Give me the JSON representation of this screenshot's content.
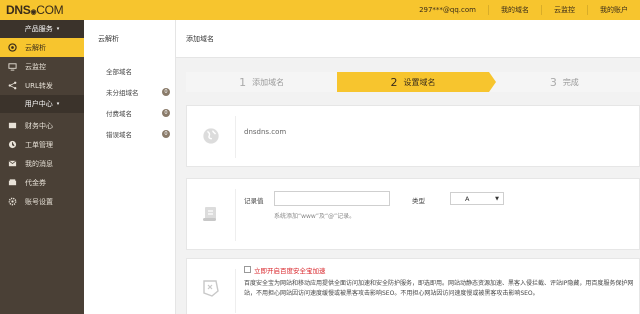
{
  "header": {
    "logo_main": "DNS",
    "logo_suffix": "COM",
    "links": [
      "297***@qq.com",
      "我的域名",
      "云监控",
      "我的账户"
    ]
  },
  "sidebar": {
    "group_products": "产品服务",
    "product_items": [
      {
        "label": "云解析",
        "icon": "cloud-dns-icon",
        "active": true
      },
      {
        "label": "云监控",
        "icon": "monitor-icon",
        "active": false
      },
      {
        "label": "URL转发",
        "icon": "share-icon",
        "active": false
      }
    ],
    "group_user": "用户中心",
    "user_items": [
      {
        "label": "财务中心",
        "icon": "finance-icon"
      },
      {
        "label": "工单管理",
        "icon": "ticket-icon"
      },
      {
        "label": "我的消息",
        "icon": "message-icon"
      },
      {
        "label": "代金券",
        "icon": "coupon-icon"
      },
      {
        "label": "账号设置",
        "icon": "gear-icon"
      }
    ]
  },
  "subsidebar": {
    "title": "云解析",
    "items": [
      {
        "label": "全部域名"
      },
      {
        "label": "未分组域名",
        "badge": "0"
      },
      {
        "label": "付费域名",
        "badge": "0"
      },
      {
        "label": "错误域名",
        "badge": "0"
      }
    ]
  },
  "main": {
    "title": "添加域名",
    "steps": [
      {
        "num": "1",
        "label": "添加域名"
      },
      {
        "num": "2",
        "label": "设置域名"
      },
      {
        "num": "3",
        "label": "完成"
      }
    ],
    "domain": "dnsdns.com",
    "record_label": "记录值",
    "record_value": "",
    "record_hint": "系统添加“www”及“@”记录。",
    "type_label": "类型",
    "type_value": "A",
    "security_label": "立即开启百度安全宝加速",
    "security_desc": "百度安全宝为网站和移动应用提供全面访问加速和安全防护服务，即选即用。网站动静态资源加速、黑客入侵拦截、评站IP隐藏，用百度服务保护网站，不用担心网站因访问速度缓慢或被黑客攻击影响SEO。不用担心网站因访问速度慢或被黑客攻击影响SEO。"
  },
  "colors": {
    "brand_yellow": "#f7c52e",
    "sidebar_bg": "#4a4036",
    "alert_red": "#d9262b"
  }
}
